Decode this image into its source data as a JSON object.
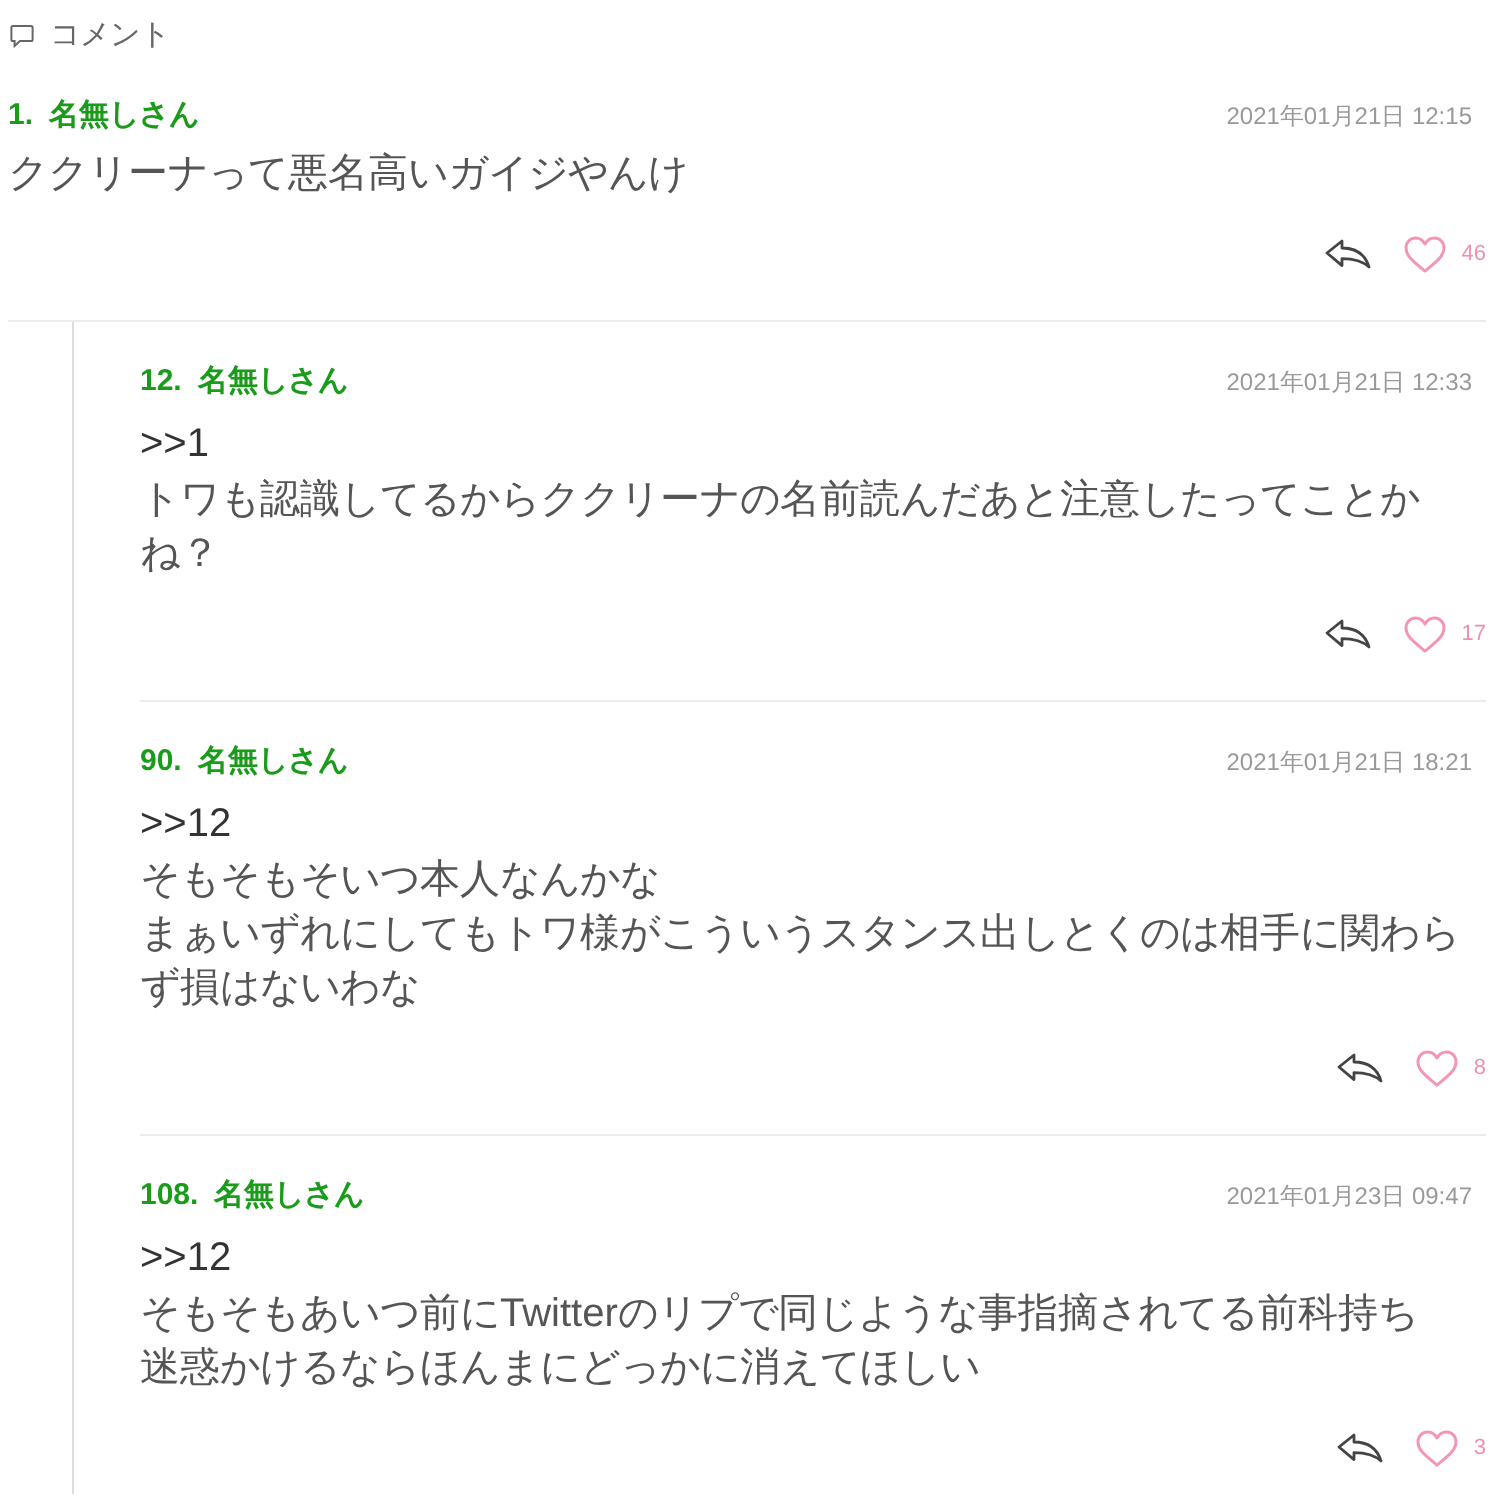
{
  "header": {
    "title": "コメント"
  },
  "comments": [
    {
      "number": "1.",
      "author": "名無しさん",
      "date": "2021年01月21日 12:15",
      "lines": [
        "ククリーナって悪名高いガイジやんけ"
      ],
      "likes": "46",
      "children": [
        {
          "number": "12.",
          "author": "名無しさん",
          "date": "2021年01月21日 12:33",
          "anchor": ">>1",
          "lines": [
            "トワも認識してるからククリーナの名前読んだあと注意したってことかね？"
          ],
          "likes": "17"
        },
        {
          "number": "90.",
          "author": "名無しさん",
          "date": "2021年01月21日 18:21",
          "anchor": ">>12",
          "lines": [
            "そもそもそいつ本人なんかな",
            "まぁいずれにしてもトワ様がこういうスタンス出しとくのは相手に関わらず損はないわな"
          ],
          "likes": "8"
        },
        {
          "number": "108.",
          "author": "名無しさん",
          "date": "2021年01月23日 09:47",
          "anchor": ">>12",
          "lines": [
            "そもそもあいつ前にTwitterのリプで同じような事指摘されてる前科持ち",
            "迷惑かけるならほんまにどっかに消えてほしい"
          ],
          "likes": "3"
        }
      ]
    }
  ]
}
